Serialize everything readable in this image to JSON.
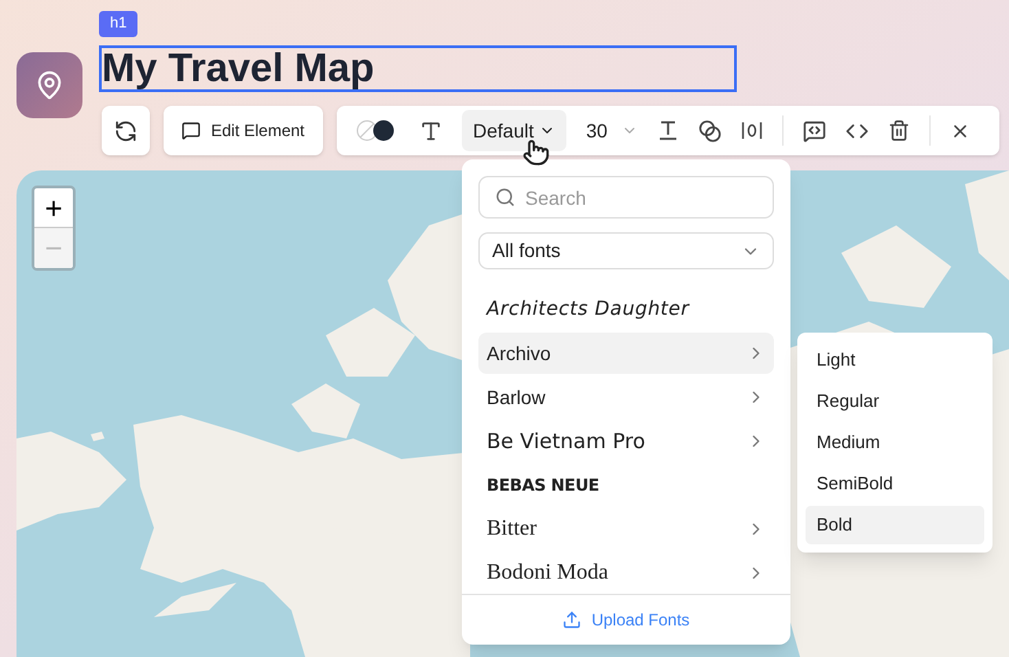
{
  "element_tag": "h1",
  "page": {
    "title": "My Travel Map"
  },
  "element_toolbar": {
    "edit_button": "Edit Element"
  },
  "format_toolbar": {
    "font_button": "Default",
    "font_menu_open": true,
    "size": "30"
  },
  "map": {
    "zoom_in": "+",
    "zoom_out": "−",
    "zoom_out_disabled": true
  },
  "font_menu": {
    "search": {
      "placeholder": "Search"
    },
    "filter": "All fonts",
    "fonts": [
      {
        "name": "Architects Daughter",
        "kind": "script",
        "selected": false,
        "has_weights": false
      },
      {
        "name": "Archivo",
        "kind": "sans",
        "selected": true,
        "has_weights": true
      },
      {
        "name": "Barlow",
        "kind": "sans",
        "selected": false,
        "has_weights": true
      },
      {
        "name": "Be Vietnam Pro",
        "kind": "wide",
        "selected": false,
        "has_weights": true
      },
      {
        "name": "BEBAS NEUE",
        "kind": "display",
        "selected": false,
        "has_weights": false
      },
      {
        "name": "Bitter",
        "kind": "serif",
        "selected": false,
        "has_weights": true
      },
      {
        "name": "Bodoni Moda",
        "kind": "serif",
        "selected": false,
        "has_weights": true
      }
    ],
    "upload": "Upload Fonts"
  },
  "weight_menu": [
    {
      "label": "Light",
      "selected": false
    },
    {
      "label": "Regular",
      "selected": false
    },
    {
      "label": "Medium",
      "selected": false
    },
    {
      "label": "SemiBold",
      "selected": false
    },
    {
      "label": "Bold",
      "selected": true
    }
  ]
}
